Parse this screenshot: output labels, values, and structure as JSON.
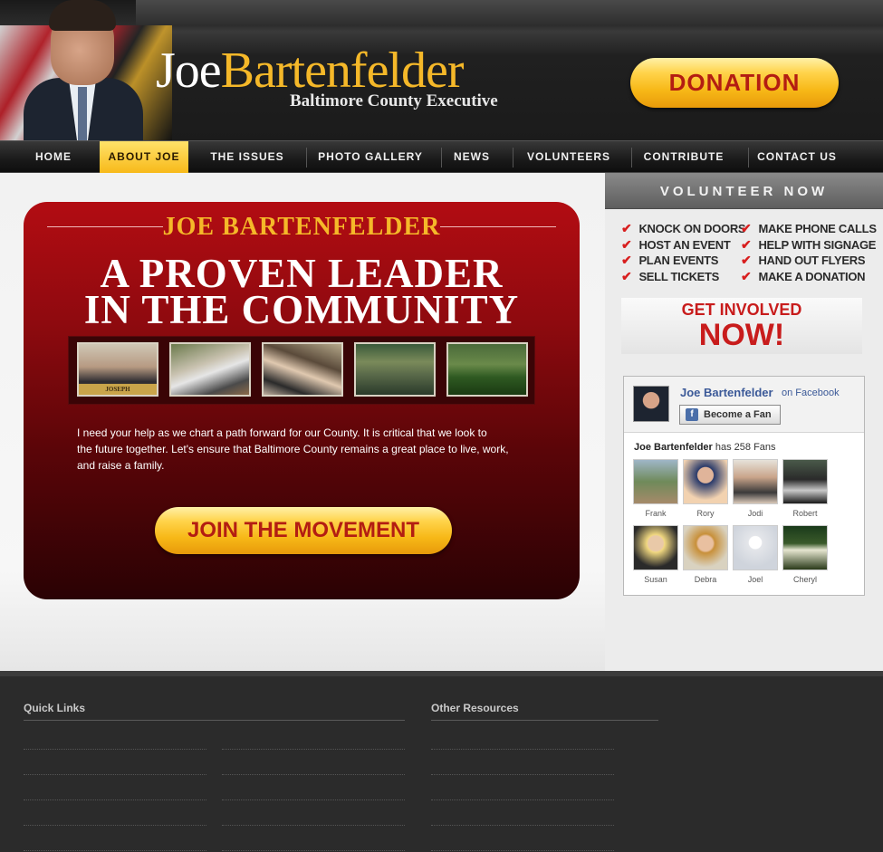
{
  "header": {
    "name_first": "Joe",
    "name_last": "Bartenfelder",
    "subtitle": "Baltimore County Executive",
    "donation_label": "DONATION"
  },
  "nav": {
    "items": [
      {
        "label": "HOME"
      },
      {
        "label": "ABOUT JOE"
      },
      {
        "label": "THE ISSUES"
      },
      {
        "label": "PHOTO GALLERY"
      },
      {
        "label": "NEWS"
      },
      {
        "label": "VOLUNTEERS"
      },
      {
        "label": "CONTRIBUTE"
      },
      {
        "label": "CONTACT US"
      }
    ],
    "active": "ABOUT JOE"
  },
  "hero": {
    "name": "JOE BARTENFELDER",
    "headline_line1": "A PROVEN LEADER",
    "headline_line2": "IN THE COMMUNITY",
    "nameplate": "JOSEPH BARTENFELDER",
    "body_line1": "I need your help as we chart a path forward for our County. It is critical that we look to",
    "body_line2": "the future together. Let's ensure that Baltimore County remains a great place to live, work,",
    "body_line3": "and raise a family.",
    "cta_label": "JOIN THE MOVEMENT"
  },
  "sidebar": {
    "volunteer_title": "VOLUNTEER NOW",
    "tasks": [
      {
        "label": "KNOCK ON DOORS"
      },
      {
        "label": "MAKE PHONE CALLS"
      },
      {
        "label": "HOST AN EVENT"
      },
      {
        "label": "HELP WITH SIGNAGE"
      },
      {
        "label": "PLAN EVENTS"
      },
      {
        "label": "HAND OUT FLYERS"
      },
      {
        "label": "SELL TICKETS"
      },
      {
        "label": "MAKE A DONATION"
      }
    ],
    "get_involved_line1": "GET INVOLVED",
    "get_involved_line2": "NOW!"
  },
  "facebook": {
    "page_name": "Joe Bartenfelder",
    "on_facebook": "on Facebook",
    "fan_button": "Become a Fan",
    "fans_name": "Joe Bartenfelder",
    "fans_count_text": "has 258 Fans",
    "fans": [
      {
        "name": "Frank"
      },
      {
        "name": "Rory"
      },
      {
        "name": "Jodi"
      },
      {
        "name": "Robert"
      },
      {
        "name": "Susan"
      },
      {
        "name": "Debra"
      },
      {
        "name": "Joel"
      },
      {
        "name": "Cheryl"
      }
    ]
  },
  "footer": {
    "quick_links_title": "Quick Links",
    "other_resources_title": "Other Resources"
  },
  "colors": {
    "accent_gold": "#f5b829",
    "hero_red": "#b20c12",
    "facebook_blue": "#3b5998",
    "check_red": "#d81e1e"
  }
}
